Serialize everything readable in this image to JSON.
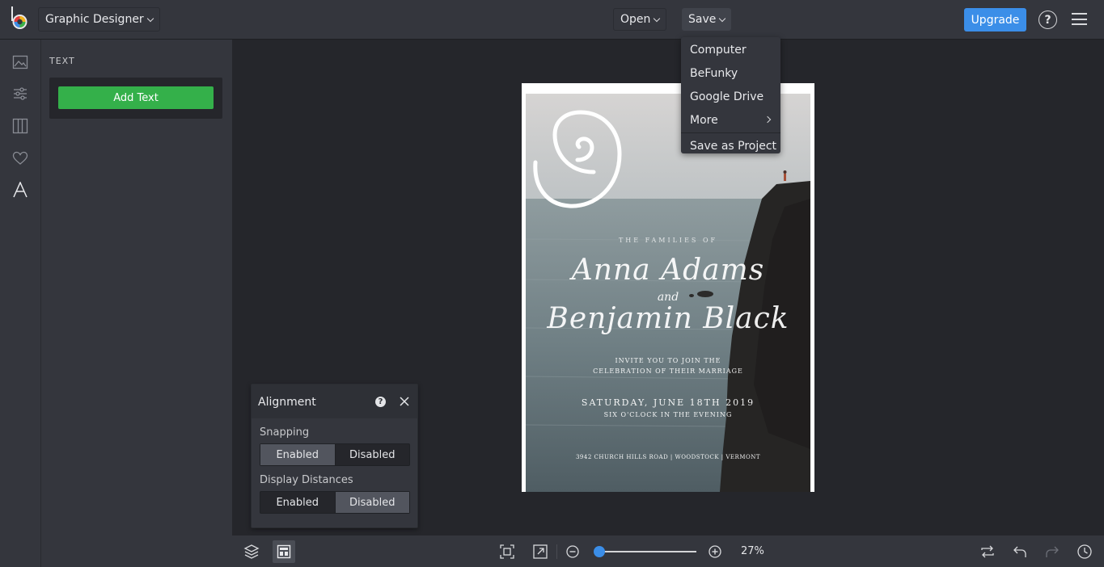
{
  "app": {
    "mode_label": "Graphic Designer",
    "open_label": "Open",
    "save_label": "Save",
    "upgrade_label": "Upgrade",
    "help_glyph": "?",
    "brand_color": "#3b8ee8"
  },
  "save_menu": {
    "items": [
      "Computer",
      "BeFunky",
      "Google Drive",
      "More"
    ],
    "project_item": "Save as Project"
  },
  "sidebar": {
    "icons": [
      "image-icon",
      "sliders-icon",
      "columns-icon",
      "heart-icon",
      "text-icon"
    ],
    "active": "text-icon"
  },
  "panel": {
    "title": "TEXT",
    "add_text_label": "Add Text",
    "add_text_color": "#34b04a"
  },
  "invitation": {
    "line1": "THE FAMILIES OF",
    "name1": "Anna Adams",
    "and": "and",
    "name2": "Benjamin Black",
    "invite1": "INVITE YOU TO JOIN THE",
    "invite2": "CELEBRATION OF THEIR MARRIAGE",
    "date": "SATURDAY, JUNE 18TH 2019",
    "time": "SIX O'CLOCK IN THE EVENING",
    "address": "3942 CHURCH HILLS ROAD | WOODSTOCK | VERMONT"
  },
  "alignment": {
    "title": "Alignment",
    "help_glyph": "?",
    "snapping_label": "Snapping",
    "snapping_enabled": "Enabled",
    "snapping_disabled": "Disabled",
    "snapping_state": "Enabled",
    "distances_label": "Display Distances",
    "distances_enabled": "Enabled",
    "distances_disabled": "Disabled",
    "distances_state": "Disabled"
  },
  "bottom": {
    "zoom_label": "27%",
    "zoom_value": 27
  }
}
